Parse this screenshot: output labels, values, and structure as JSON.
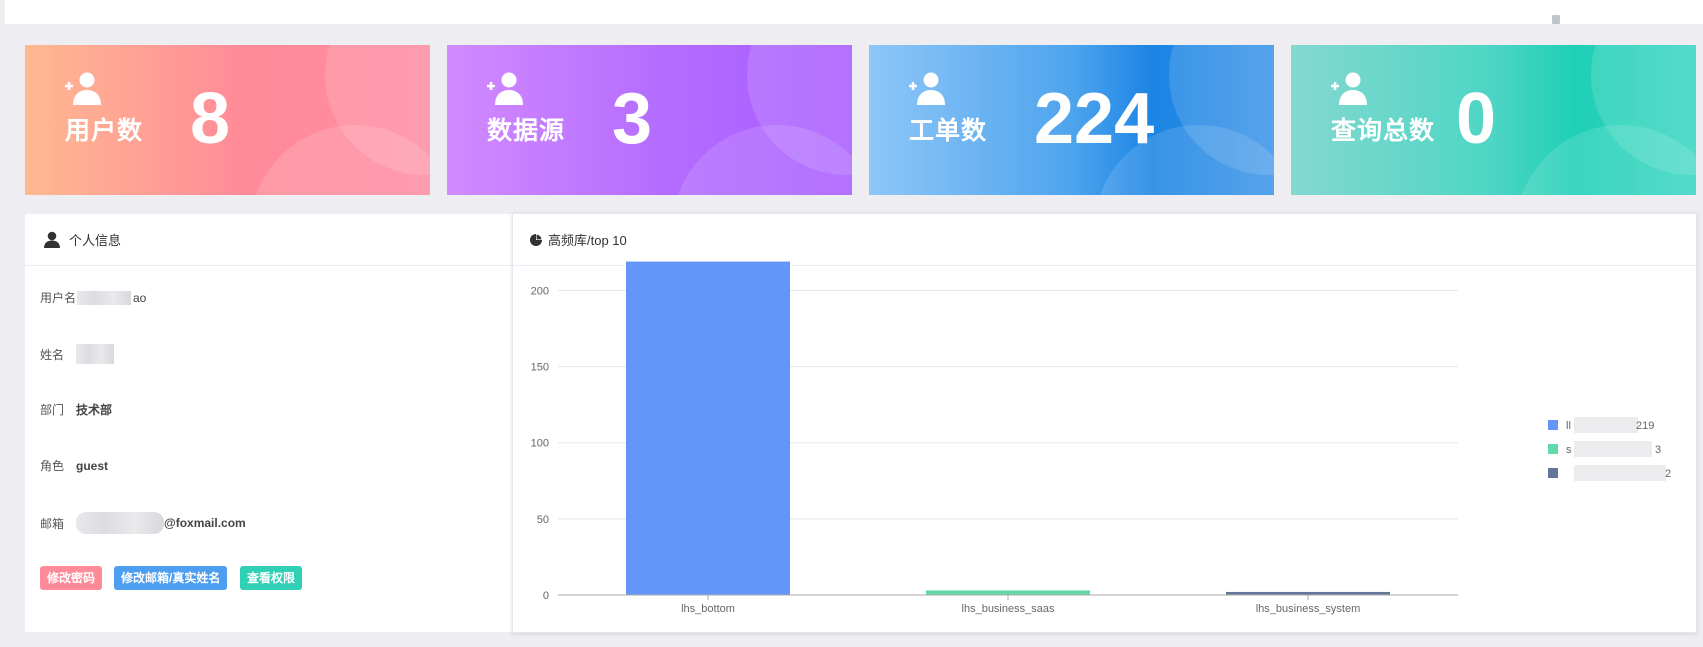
{
  "stats": [
    {
      "label": "用户数",
      "value": "8"
    },
    {
      "label": "数据源",
      "value": "3"
    },
    {
      "label": "工单数",
      "value": "224"
    },
    {
      "label": "查询总数",
      "value": "0"
    }
  ],
  "profile": {
    "title": "个人信息",
    "rows": [
      {
        "key": "用户名",
        "value": "ao"
      },
      {
        "key": "姓名",
        "value": ""
      },
      {
        "key": "部门",
        "value": "技术部"
      },
      {
        "key": "角色",
        "value": "guest"
      },
      {
        "key": "邮箱",
        "value": "@foxmail.com"
      }
    ],
    "buttons": {
      "change_password": "修改密码",
      "change_email": "修改邮箱/真实姓名",
      "view_permissions": "查看权限"
    }
  },
  "chart_panel": {
    "title": "高频库/top 10"
  },
  "colors": {
    "bar1": "#6495f9",
    "bar2": "#62d9a8",
    "bar3": "#637699",
    "grid": "#e4e7ed",
    "axis": "#aaaaaa",
    "tick": "#666666"
  },
  "chart_data": {
    "type": "bar",
    "categories": [
      "lhs_bottom",
      "lhs_business_saas",
      "lhs_business_system"
    ],
    "values": [
      219,
      3,
      2
    ],
    "ylim": [
      0,
      200
    ],
    "yticks": [
      0,
      50,
      100,
      150,
      200
    ],
    "grid": true,
    "legend": {
      "placement": "right",
      "entries": [
        {
          "label": "ll",
          "value": "219"
        },
        {
          "label": "s",
          "value": "3"
        },
        {
          "label": "",
          "value": "2"
        }
      ]
    }
  }
}
